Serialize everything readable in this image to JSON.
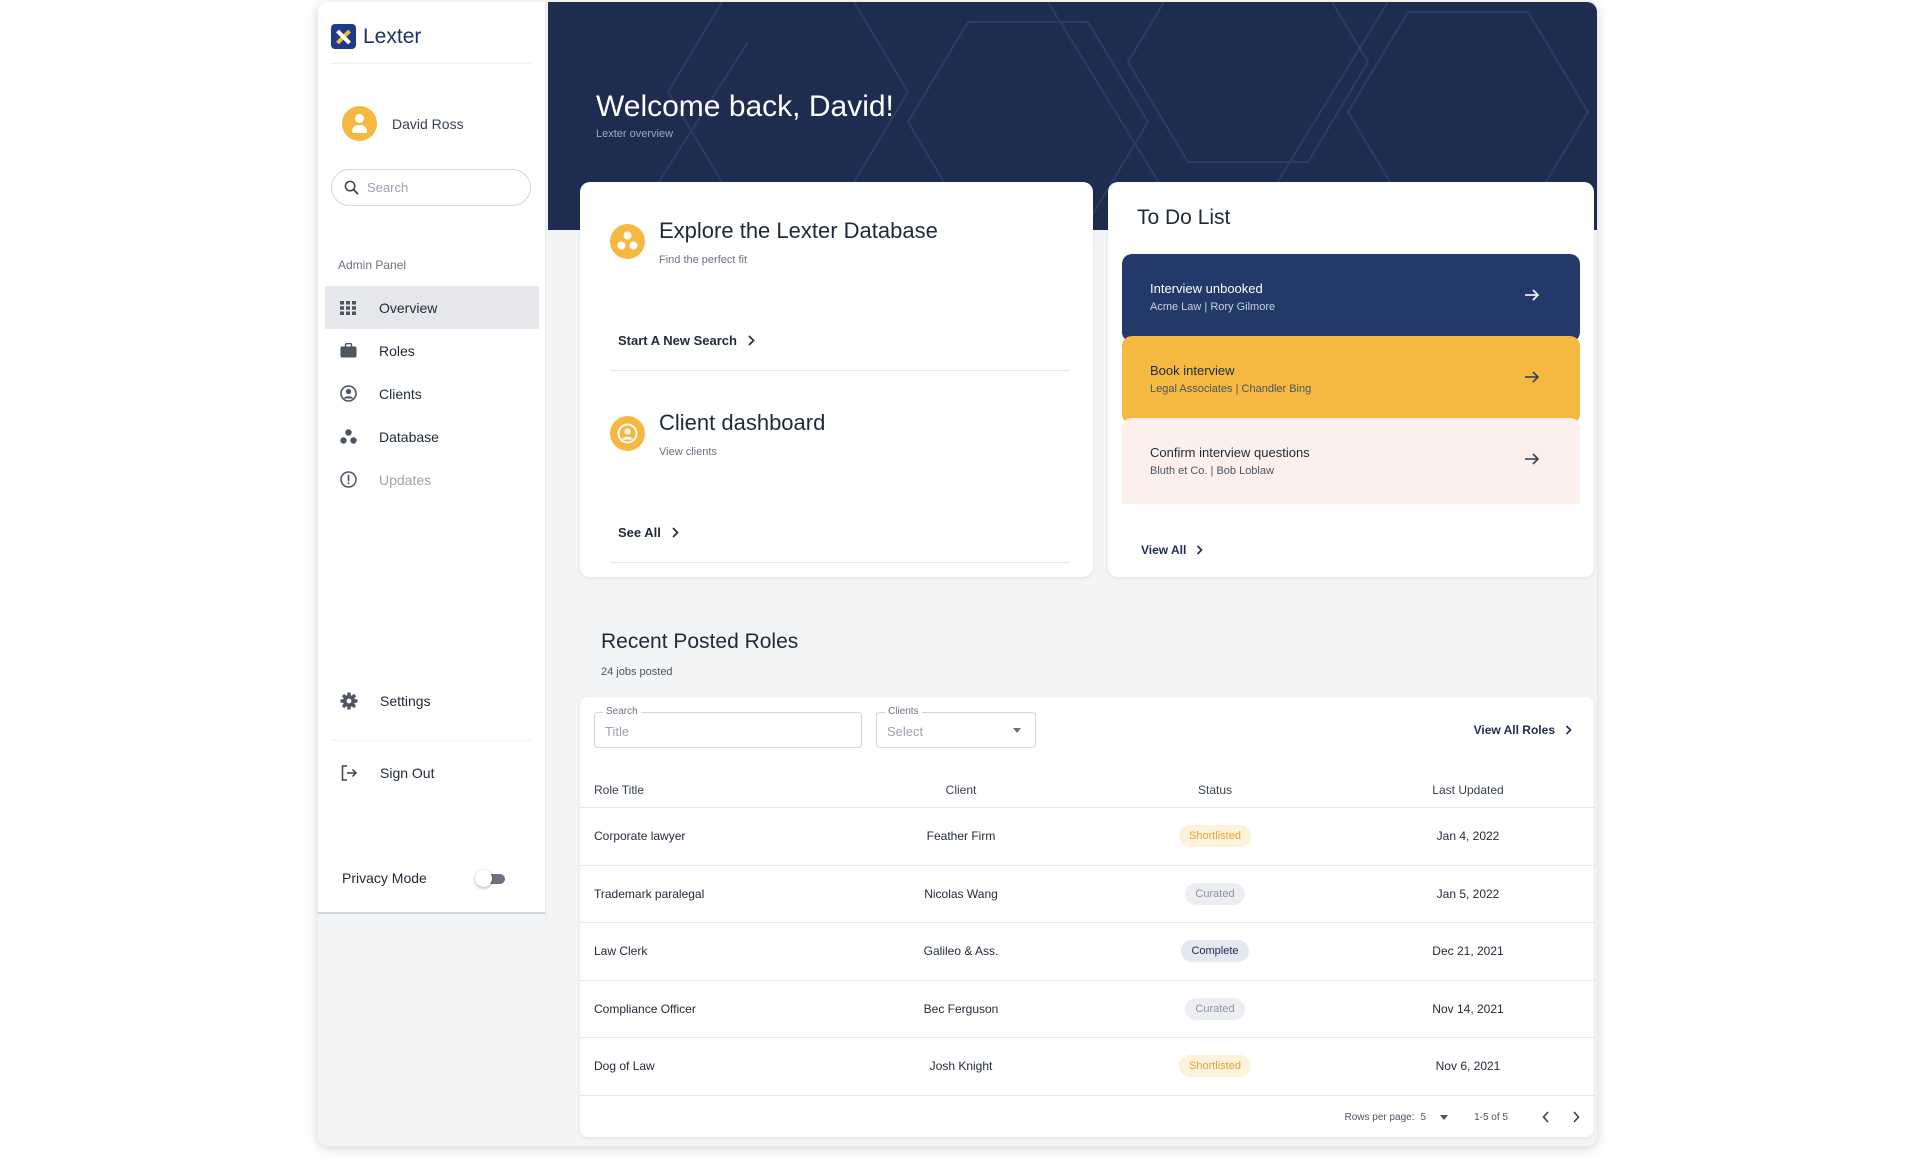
{
  "brand": {
    "name": "Lexter"
  },
  "user": {
    "name": "David Ross"
  },
  "sidebar": {
    "search_placeholder": "Search",
    "section_label": "Admin Panel",
    "items": [
      {
        "label": "Overview",
        "icon": "grid-icon",
        "active": true
      },
      {
        "label": "Roles",
        "icon": "briefcase-icon"
      },
      {
        "label": "Clients",
        "icon": "user-circle-icon"
      },
      {
        "label": "Database",
        "icon": "database-icon"
      },
      {
        "label": "Updates",
        "icon": "alert-circle-icon",
        "disabled": true
      }
    ],
    "settings_label": "Settings",
    "signout_label": "Sign Out",
    "privacy_label": "Privacy Mode",
    "privacy_on": false
  },
  "hero": {
    "title": "Welcome back, David!",
    "subtitle": "Lexter overview"
  },
  "explore": {
    "title": "Explore the Lexter Database",
    "subtitle": "Find the perfect fit",
    "link": "Start A New Search"
  },
  "client_dash": {
    "title": "Client dashboard",
    "subtitle": "View clients",
    "link": "See All"
  },
  "todo": {
    "title": "To Do List",
    "items": [
      {
        "title": "Interview unbooked",
        "sub": "Acme Law | Rory Gilmore"
      },
      {
        "title": "Book interview",
        "sub": "Legal Associates | Chandler Bing"
      },
      {
        "title": "Confirm interview questions",
        "sub": "Bluth et Co. | Bob Loblaw"
      }
    ],
    "view_all": "View All"
  },
  "recent": {
    "title": "Recent Posted Roles",
    "subtitle": "24 jobs posted",
    "search_label": "Search",
    "search_placeholder": "Title",
    "clients_label": "Clients",
    "clients_placeholder": "Select",
    "view_all": "View All Roles",
    "columns": [
      "Role Title",
      "Client",
      "Status",
      "Last Updated"
    ],
    "rows": [
      {
        "title": "Corporate lawyer",
        "client": "Feather Firm",
        "status": "Shortlisted",
        "updated": "Jan 4, 2022"
      },
      {
        "title": "Trademark paralegal",
        "client": "Nicolas Wang",
        "status": "Curated",
        "updated": "Jan 5, 2022"
      },
      {
        "title": "Law Clerk",
        "client": "Galileo & Ass.",
        "status": "Complete",
        "updated": "Dec 21, 2021"
      },
      {
        "title": "Compliance Officer",
        "client": "Bec Ferguson",
        "status": "Curated",
        "updated": "Nov 14, 2021"
      },
      {
        "title": "Dog of Law",
        "client": "Josh Knight",
        "status": "Shortlisted",
        "updated": "Nov 6, 2021"
      }
    ],
    "rows_per_page_label": "Rows per page:",
    "rows_per_page": "5",
    "range": "1-5 of 5"
  },
  "colors": {
    "navy": "#1e2c4f",
    "accent": "#f5b942",
    "shortlisted_bg": "#fdf2dc",
    "shortlisted_text": "#e0a33a",
    "curated_bg": "#eceef1",
    "curated_text": "#8b95a3",
    "complete_bg": "#e3e8f1",
    "complete_text": "#1e2c4f"
  }
}
